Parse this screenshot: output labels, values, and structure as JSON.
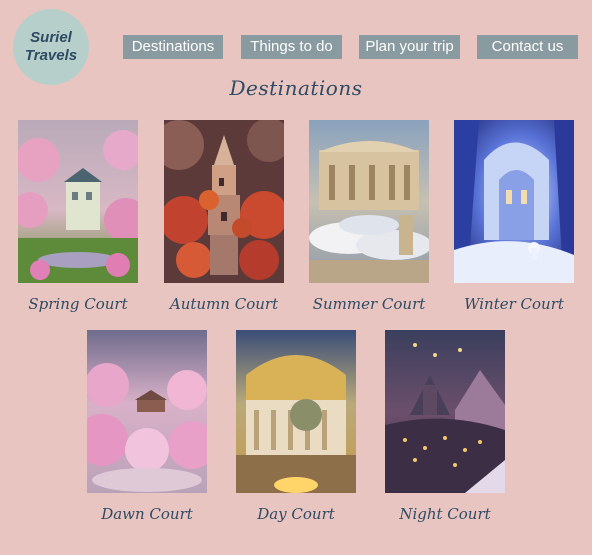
{
  "brand": {
    "line1": "Suriel",
    "line2": "Travels"
  },
  "nav": [
    {
      "label": "Destinations"
    },
    {
      "label": "Things to do"
    },
    {
      "label": "Plan your trip"
    },
    {
      "label": "Contact us"
    }
  ],
  "section_title": "Destinations",
  "destinations": [
    {
      "caption": "Spring Court"
    },
    {
      "caption": "Autumn Court"
    },
    {
      "caption": "Summer Court"
    },
    {
      "caption": "Winter Court"
    },
    {
      "caption": "Dawn Court"
    },
    {
      "caption": "Day Court"
    },
    {
      "caption": "Night Court"
    }
  ],
  "colors": {
    "background": "#e9c5c1",
    "nav": "#8a9aa1",
    "text": "#2f4b63",
    "logo": "#b6cfcb"
  }
}
